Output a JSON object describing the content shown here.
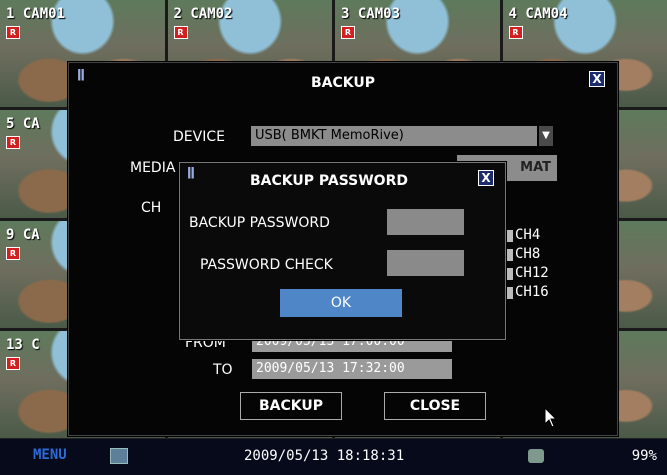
{
  "cameras": [
    {
      "label": "1 CAM01"
    },
    {
      "label": "2 CAM02"
    },
    {
      "label": "3 CAM03"
    },
    {
      "label": "4 CAM04"
    },
    {
      "label": "5 CA"
    },
    {
      "label": ""
    },
    {
      "label": ""
    },
    {
      "label": ""
    },
    {
      "label": "9 CA"
    },
    {
      "label": ""
    },
    {
      "label": ""
    },
    {
      "label": ""
    },
    {
      "label": "13 C"
    },
    {
      "label": ""
    },
    {
      "label": ""
    },
    {
      "label": ""
    }
  ],
  "rec_badge": "R",
  "backup": {
    "title": "BACKUP",
    "close_label": "X",
    "device_label": "DEVICE",
    "device_value": "USB( BMKT MemoRive)",
    "media_label": "MEDIA",
    "format_label": "MAT",
    "channel_label": "CH",
    "channels": [
      "CH4",
      "CH8",
      "CH12",
      "CH16"
    ],
    "from_label": "FROM",
    "from_value": "2009/05/13 17:00:00",
    "to_label": "TO",
    "to_value": "2009/05/13 17:32:00",
    "backup_button": "BACKUP",
    "close_button": "CLOSE"
  },
  "password_dialog": {
    "title": "BACKUP PASSWORD",
    "close_label": "X",
    "password_label": "BACKUP PASSWORD",
    "check_label": "PASSWORD CHECK",
    "ok_button": "OK"
  },
  "status_bar": {
    "menu_label": "MENU",
    "datetime": "2009/05/13 18:18:31",
    "disk": "99%"
  }
}
